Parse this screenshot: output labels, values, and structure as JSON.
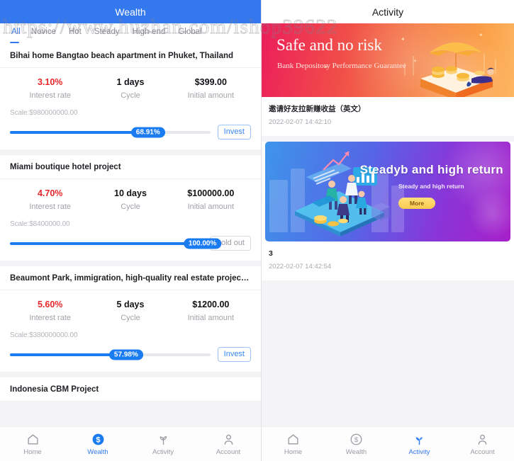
{
  "watermark": "https://www.huzhan.com/ishop39622",
  "theme": {
    "accent_blue": "#3478ed",
    "progress_blue": "#1a7cf0",
    "rate_red": "#e8262a",
    "page_bg": "#f4f4f6",
    "card_bg": "#ffffff",
    "muted_text": "#a2a2aa"
  },
  "left_panel": {
    "header": {
      "title": "Wealth"
    },
    "tabs": [
      {
        "label": "All",
        "active": true
      },
      {
        "label": "Novice",
        "active": false
      },
      {
        "label": "Hot",
        "active": false
      },
      {
        "label": "Steady",
        "active": false
      },
      {
        "label": "High-end",
        "active": false
      },
      {
        "label": "Global",
        "active": false
      }
    ],
    "stat_labels": {
      "rate": "Interest rate",
      "cycle": "Cycle",
      "amount": "Initial amount"
    },
    "products": [
      {
        "title": "Bihai home Bangtao beach apartment in Phuket, Thailand",
        "interest_rate": "3.10%",
        "cycle": "1 days",
        "initial_amount": "$399.00",
        "scale": "Scale:$980000000.00",
        "progress_text": "68.91%",
        "progress_value": 68.91,
        "action_label": "Invest",
        "action_state": "invest"
      },
      {
        "title": "Miami boutique hotel project",
        "interest_rate": "4.70%",
        "cycle": "10 days",
        "initial_amount": "$100000.00",
        "scale": "Scale:$8400000.00",
        "progress_text": "100.00%",
        "progress_value": 100,
        "action_label": "Sold out",
        "action_state": "soldout"
      },
      {
        "title": "Beaumont Park, immigration, high-quality real estate project in  St. …",
        "interest_rate": "5.60%",
        "cycle": "5 days",
        "initial_amount": "$1200.00",
        "scale": "Scale:$380000000.00",
        "progress_text": "57.98%",
        "progress_value": 57.98,
        "action_label": "Invest",
        "action_state": "invest"
      },
      {
        "title": "Indonesia CBM Project",
        "interest_rate": "",
        "cycle": "",
        "initial_amount": "",
        "scale": "",
        "progress_text": "",
        "progress_value": 0,
        "action_label": "",
        "action_state": "none"
      }
    ],
    "tabbar": [
      {
        "label": "Home",
        "icon": "home-icon",
        "active": false
      },
      {
        "label": "Wealth",
        "icon": "dollar-circle-icon",
        "active": true
      },
      {
        "label": "Activity",
        "icon": "sprout-icon",
        "active": false
      },
      {
        "label": "Account",
        "icon": "person-icon",
        "active": false
      }
    ]
  },
  "right_panel": {
    "header": {
      "title": "Activity"
    },
    "activities": [
      {
        "banner_title": "Safe and no risk",
        "banner_subtitle": "Bank Depository Performance Guarantee",
        "banner_button": "",
        "name": "邀请好友拉新赚收益（英文）",
        "date": "2022-02-07 14:42:10"
      },
      {
        "banner_title": "Steadyb and high return",
        "banner_subtitle": "Steady and high return",
        "banner_button": "More",
        "name": "3",
        "date": "2022-02-07 14:42:54"
      }
    ],
    "tabbar": [
      {
        "label": "Home",
        "icon": "home-icon",
        "active": false
      },
      {
        "label": "Wealth",
        "icon": "dollar-circle-icon",
        "active": false
      },
      {
        "label": "Activity",
        "icon": "sprout-icon",
        "active": true
      },
      {
        "label": "Account",
        "icon": "person-icon",
        "active": false
      }
    ]
  }
}
